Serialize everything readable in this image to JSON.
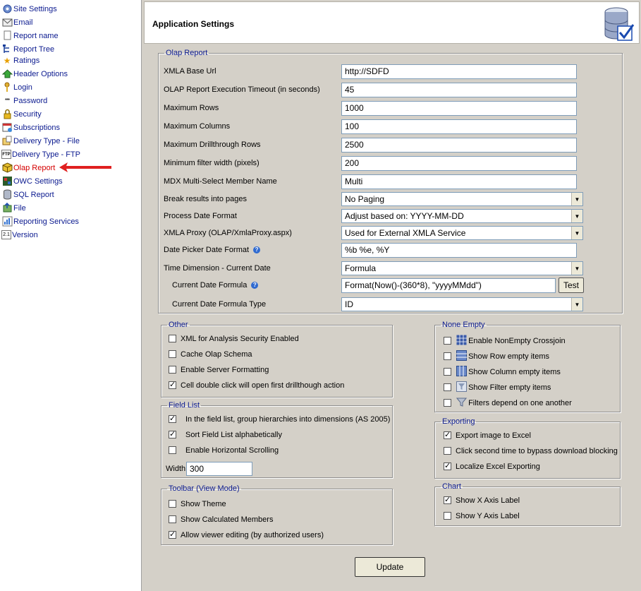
{
  "sidebar": {
    "items": [
      {
        "label": "Site Settings",
        "icon": "gear-icon"
      },
      {
        "label": "Email",
        "icon": "email-icon"
      },
      {
        "label": "Report name",
        "icon": "document-icon"
      },
      {
        "label": "Report Tree",
        "icon": "tree-icon"
      },
      {
        "label": "Ratings",
        "icon": "star-icon"
      },
      {
        "label": "Header Options",
        "icon": "home-icon"
      },
      {
        "label": "Login",
        "icon": "key-icon"
      },
      {
        "label": "Password",
        "icon": "password-icon"
      },
      {
        "label": "Security",
        "icon": "lock-icon"
      },
      {
        "label": "Subscriptions",
        "icon": "calendar-icon"
      },
      {
        "label": "Delivery Type - File",
        "icon": "file-delivery-icon"
      },
      {
        "label": "Delivery Type - FTP",
        "icon": "ftp-icon"
      },
      {
        "label": "Olap Report",
        "icon": "cube-icon"
      },
      {
        "label": "OWC Settings",
        "icon": "owc-icon"
      },
      {
        "label": "SQL Report",
        "icon": "database-icon"
      },
      {
        "label": "File",
        "icon": "file-icon"
      },
      {
        "label": "Reporting Services",
        "icon": "chart-icon"
      },
      {
        "label": "Version",
        "icon": "version-icon"
      }
    ],
    "active": "Olap Report",
    "arrow_color": "#e02020"
  },
  "header": {
    "title": "Application Settings",
    "icon": "database-check-icon"
  },
  "olap": {
    "legend": "Olap Report",
    "xmla_base_url": {
      "label": "XMLA Base Url",
      "value": "http://SDFD"
    },
    "exec_timeout": {
      "label": "OLAP Report Execution Timeout (in seconds)",
      "value": "45"
    },
    "max_rows": {
      "label": "Maximum Rows",
      "value": "1000"
    },
    "max_columns": {
      "label": "Maximum Columns",
      "value": "100"
    },
    "max_drillthrough": {
      "label": "Maximum Drillthrough Rows",
      "value": "2500"
    },
    "min_filter_width": {
      "label": "Minimum filter width (pixels)",
      "value": "200"
    },
    "mdx_member_name": {
      "label": "MDX Multi-Select Member Name",
      "value": "Multi"
    },
    "break_pages": {
      "label": "Break results into pages",
      "value": "No Paging"
    },
    "date_format": {
      "label": "Process Date Format",
      "value": "Adjust based on: YYYY-MM-DD"
    },
    "xmla_proxy": {
      "label": "XMLA Proxy (OLAP/XmlaProxy.aspx)",
      "value": "Used for External XMLA Service"
    },
    "picker_format": {
      "label": "Date Picker Date Format",
      "value": "%b %e, %Y"
    },
    "time_dimension": {
      "label": "Time Dimension - Current Date",
      "value": "Formula"
    },
    "current_formula": {
      "label": "Current Date Formula",
      "value": "Format(Now()-(360*8), \"yyyyMMdd\")",
      "button": "Test"
    },
    "formula_type": {
      "label": "Current Date Formula Type",
      "value": "ID"
    }
  },
  "other": {
    "legend": "Other",
    "items": [
      {
        "label": "XML for Analysis Security Enabled",
        "checked": false
      },
      {
        "label": "Cache Olap Schema",
        "checked": false
      },
      {
        "label": "Enable Server Formatting",
        "checked": false
      },
      {
        "label": "Cell double click will open first drillthough action",
        "checked": true
      }
    ]
  },
  "field_list": {
    "legend": "Field List",
    "items": [
      {
        "label": "In the field list, group hierarchies into dimensions (AS 2005)",
        "checked": true
      },
      {
        "label": "Sort Field List alphabetically",
        "checked": true
      },
      {
        "label": "Enable Horizontal Scrolling",
        "checked": false
      }
    ],
    "width_label": "Width",
    "width_value": "300"
  },
  "toolbar": {
    "legend": "Toolbar (View Mode)",
    "items": [
      {
        "label": "Show Theme",
        "checked": false
      },
      {
        "label": "Show Calculated Members",
        "checked": false
      },
      {
        "label": "Allow viewer editing (by authorized users)",
        "checked": true
      }
    ]
  },
  "none_empty": {
    "legend": "None Empty",
    "items": [
      {
        "label": "Enable NonEmpty Crossjoin",
        "checked": false,
        "icon": "grid-icon"
      },
      {
        "label": "Show Row empty items",
        "checked": false,
        "icon": "rows-icon"
      },
      {
        "label": "Show Column empty items",
        "checked": false,
        "icon": "columns-icon"
      },
      {
        "label": "Show Filter empty items",
        "checked": false,
        "icon": "filter-grid-icon"
      },
      {
        "label": "Filters depend on one another",
        "checked": false,
        "icon": "funnel-icon"
      }
    ]
  },
  "exporting": {
    "legend": "Exporting",
    "items": [
      {
        "label": "Export image to Excel",
        "checked": true
      },
      {
        "label": "Click second time to bypass download blocking",
        "checked": false
      },
      {
        "label": "Localize Excel Exporting",
        "checked": true
      }
    ]
  },
  "chart": {
    "legend": "Chart",
    "items": [
      {
        "label": "Show X Axis Label",
        "checked": true
      },
      {
        "label": "Show Y Axis Label",
        "checked": false
      }
    ]
  },
  "update_button": "Update"
}
